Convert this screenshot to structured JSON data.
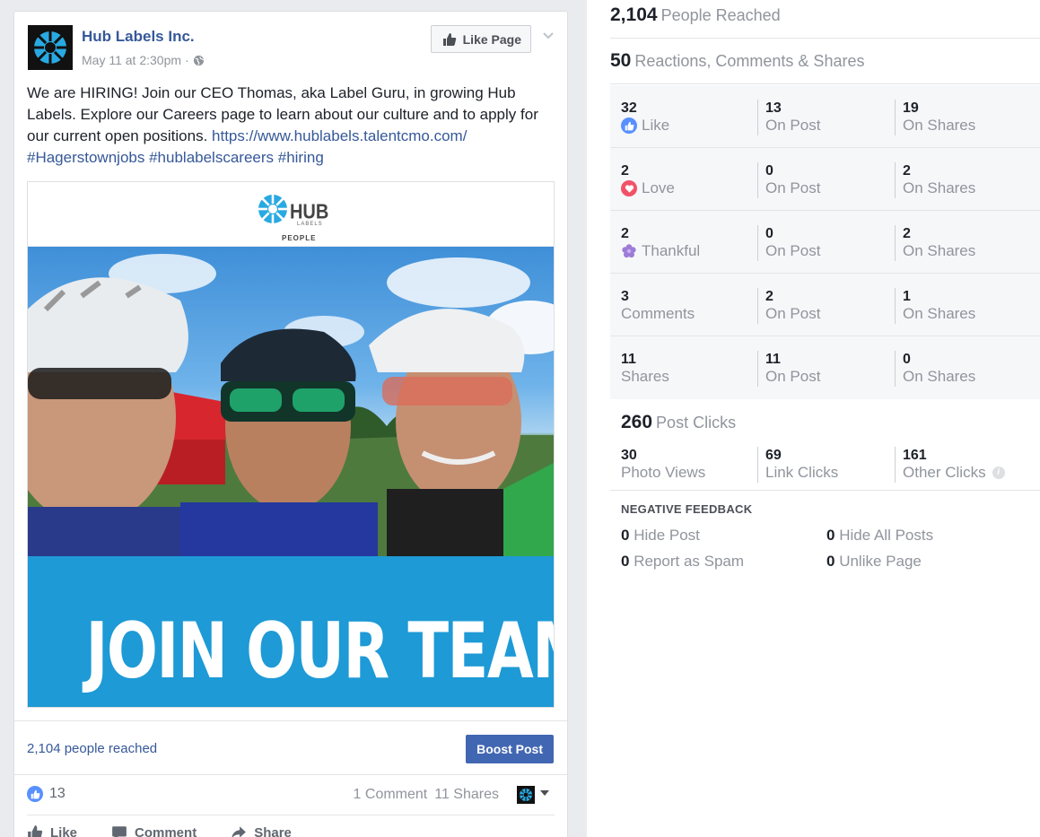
{
  "post": {
    "page_name": "Hub Labels Inc.",
    "timestamp": "May 11 at 2:30pm",
    "meta_separator": "·",
    "like_page_label": "Like Page",
    "text_main": "We are HIRING! Join our CEO Thomas, aka Label Guru, in growing Hub Labels. Explore our Careers page to learn about our culture and to apply for our current open positions. ",
    "link": "https://www.hublabels.talentcmo.com/",
    "hashtags": [
      "#Hagerstownjobs",
      "#hublabelscareers",
      "#hiring"
    ],
    "image": {
      "logo_text": "HUB",
      "logo_subtext": "LABELS",
      "logo_caption": "PEOPLE",
      "banner_text": "JOIN OUR TEAM!"
    },
    "reach_text": "2,104 people reached",
    "boost_label": "Boost Post",
    "like_count": "13",
    "comments_text": "1 Comment",
    "shares_text": "11 Shares",
    "actions": {
      "like": "Like",
      "comment": "Comment",
      "share": "Share"
    }
  },
  "insights": {
    "people_reached": {
      "value": "2,104",
      "label": "People Reached"
    },
    "reactions_total": {
      "value": "50",
      "label": "Reactions, Comments & Shares"
    },
    "rows": [
      {
        "value": "32",
        "label": "Like",
        "icon": "like-icon",
        "on_post": "13",
        "on_shares": "19"
      },
      {
        "value": "2",
        "label": "Love",
        "icon": "love-icon",
        "on_post": "0",
        "on_shares": "2"
      },
      {
        "value": "2",
        "label": "Thankful",
        "icon": "thankful-icon",
        "on_post": "0",
        "on_shares": "2"
      },
      {
        "value": "3",
        "label": "Comments",
        "on_post": "2",
        "on_shares": "1"
      },
      {
        "value": "11",
        "label": "Shares",
        "on_post": "11",
        "on_shares": "0"
      }
    ],
    "on_post_label": "On Post",
    "on_shares_label": "On Shares",
    "post_clicks": {
      "value": "260",
      "label": "Post Clicks"
    },
    "clicks": [
      {
        "value": "30",
        "label": "Photo Views"
      },
      {
        "value": "69",
        "label": "Link Clicks"
      },
      {
        "value": "161",
        "label": "Other Clicks"
      }
    ],
    "info_glyph": "i",
    "negative_title": "NEGATIVE FEEDBACK",
    "negative": [
      {
        "value": "0",
        "label": "Hide Post"
      },
      {
        "value": "0",
        "label": "Hide All Posts"
      },
      {
        "value": "0",
        "label": "Report as Spam"
      },
      {
        "value": "0",
        "label": "Unlike Page"
      }
    ]
  },
  "colors": {
    "link_blue": "#365899",
    "button_blue": "#4267b2",
    "like_blue": "#5890ff",
    "love_red": "#f25268",
    "banner_blue": "#1e9ad6"
  }
}
